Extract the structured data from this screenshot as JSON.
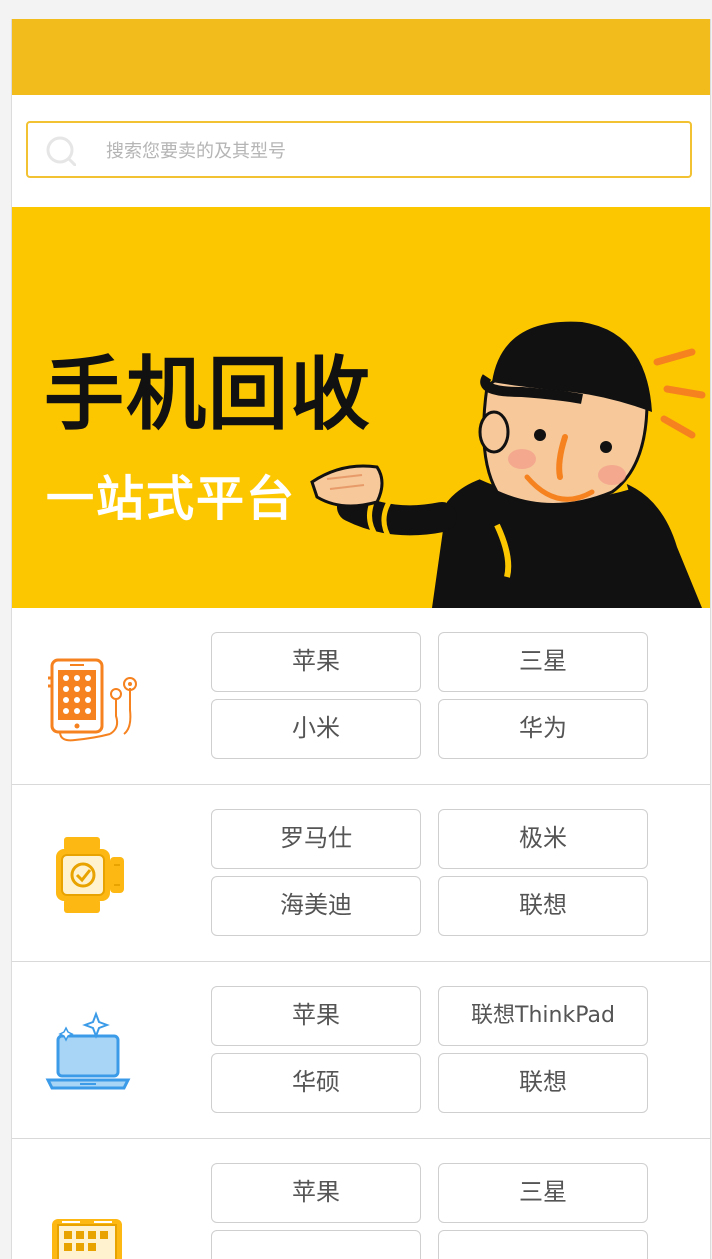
{
  "search": {
    "placeholder": "搜索您要卖的及其型号",
    "value": ""
  },
  "banner": {
    "title": "手机回收",
    "subtitle": "一站式平台"
  },
  "categories": [
    {
      "icon": "phone-icon",
      "brands": [
        "苹果",
        "三星",
        "小米",
        "华为"
      ]
    },
    {
      "icon": "smartwatch-icon",
      "brands": [
        "罗马仕",
        "极米",
        "海美迪",
        "联想"
      ]
    },
    {
      "icon": "laptop-icon",
      "brands": [
        "苹果",
        "联想ThinkPad",
        "华硕",
        "联想"
      ]
    },
    {
      "icon": "tablet-icon",
      "brands": [
        "苹果",
        "三星",
        "",
        ""
      ]
    }
  ],
  "colors": {
    "topbar": "#f2bc1c",
    "banner": "#fdc700",
    "search_border": "#f2c233",
    "icon_orange": "#f5821f",
    "icon_yellow": "#fdb813",
    "icon_blue": "#3b9be8"
  }
}
